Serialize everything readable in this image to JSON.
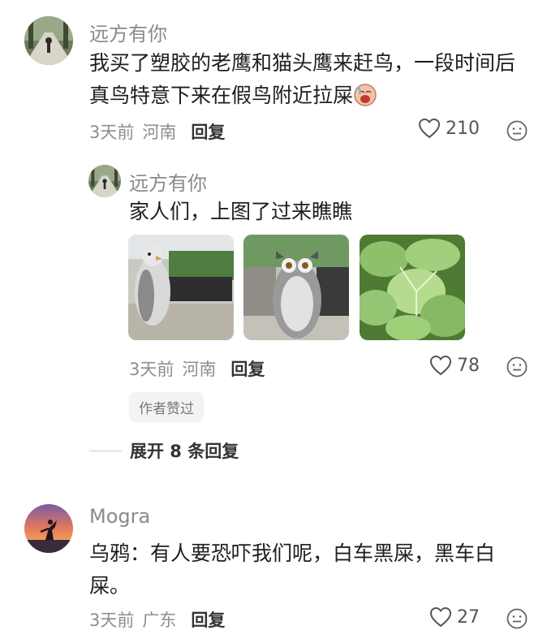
{
  "comments": [
    {
      "username": "远方有你",
      "text": "我买了塑胶的老鹰和猫头鹰来赶鸟，一段时间后真鸟特意下来在假鸟附近拉屎",
      "emoji": "sweat-laugh-emoji",
      "time": "3天前",
      "location": "河南",
      "reply_label": "回复",
      "likes": "210",
      "reply": {
        "username": "远方有你",
        "text": "家人们，上图了过来瞧瞧",
        "images": [
          "eagle-decoy-photo",
          "owl-decoy-photo",
          "lettuce-photo"
        ],
        "time": "3天前",
        "location": "河南",
        "reply_label": "回复",
        "likes": "78",
        "badge": "作者赞过"
      },
      "expand_label": "展开 8 条回复"
    },
    {
      "username": "Mogra",
      "text": "乌鸦：有人要恐吓我们呢，白车黑屎，黑车白屎。",
      "time": "3天前",
      "location": "广东",
      "reply_label": "回复",
      "likes": "27"
    }
  ],
  "icons": {
    "like": "heart-outline-icon",
    "more": "emoji-face-icon"
  },
  "colors": {
    "username": "#8a8a8a",
    "meta": "#8e8e8e",
    "text": "#1e1e1e"
  }
}
